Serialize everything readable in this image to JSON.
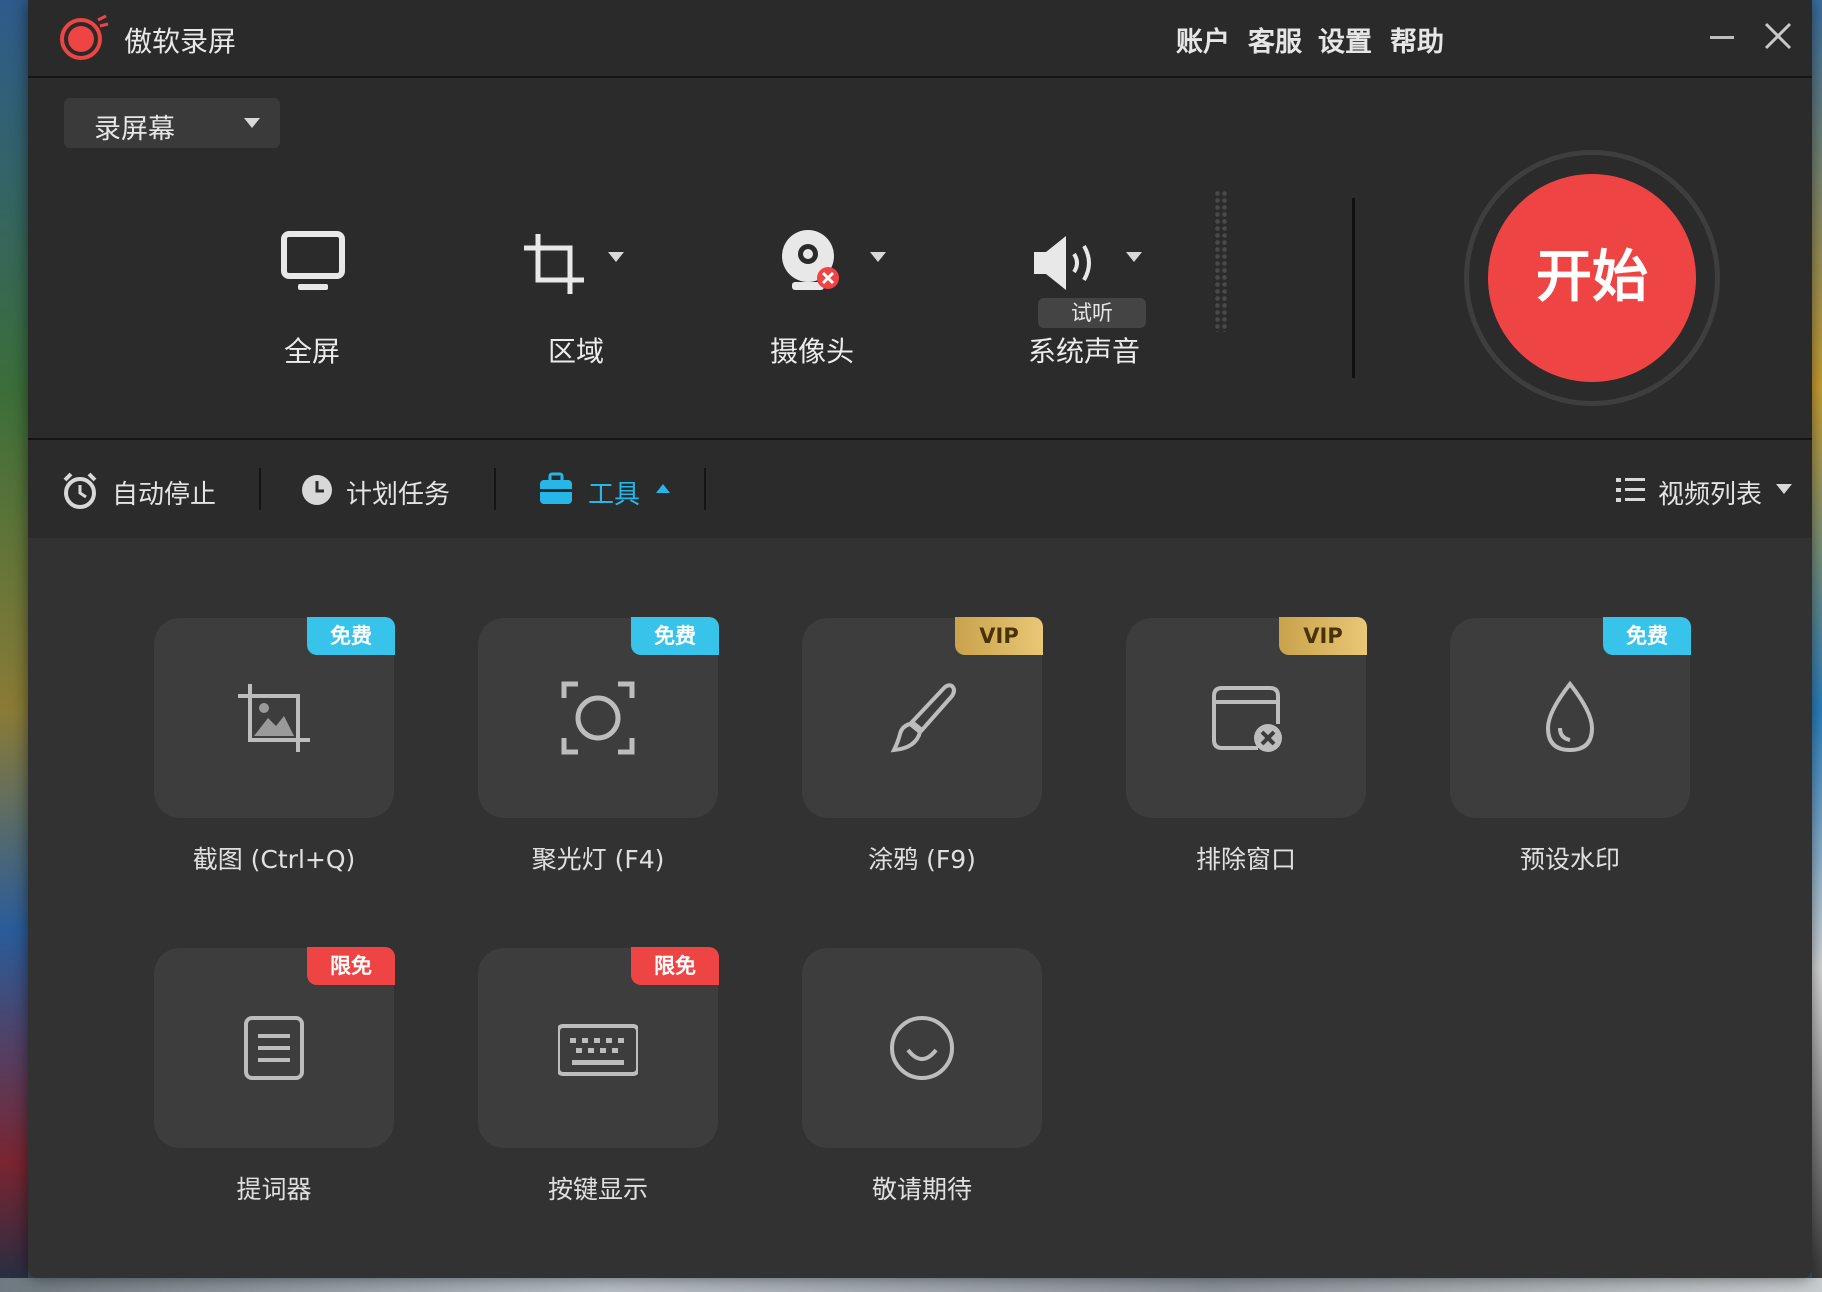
{
  "app": {
    "title": "傲软录屏",
    "menu": [
      "账户",
      "客服",
      "设置",
      "帮助"
    ]
  },
  "mode_dropdown": {
    "selected": "录屏幕"
  },
  "sources": [
    {
      "label": "全屏",
      "icon": "monitor-icon"
    },
    {
      "label": "区域",
      "icon": "crop-icon"
    },
    {
      "label": "摄像头",
      "icon": "webcam-icon"
    },
    {
      "label": "系统声音",
      "icon": "speaker-icon",
      "chip": "试听"
    }
  ],
  "start_button": {
    "label": "开始",
    "color": "#ef4444"
  },
  "toolbar": {
    "auto_stop": "自动停止",
    "schedule": "计划任务",
    "tools": "工具",
    "video_list": "视频列表"
  },
  "tools": [
    {
      "label": "截图 (Ctrl+Q)",
      "badge": "免费",
      "badge_type": "free",
      "icon": "screenshot-icon"
    },
    {
      "label": "聚光灯 (F4)",
      "badge": "免费",
      "badge_type": "free",
      "icon": "spotlight-icon"
    },
    {
      "label": "涂鸦 (F9)",
      "badge": "VIP",
      "badge_type": "vip",
      "icon": "brush-icon"
    },
    {
      "label": "排除窗口",
      "badge": "VIP",
      "badge_type": "vip",
      "icon": "exclude-window-icon"
    },
    {
      "label": "预设水印",
      "badge": "免费",
      "badge_type": "free",
      "icon": "watermark-drop-icon"
    },
    {
      "label": "提词器",
      "badge": "限免",
      "badge_type": "limited",
      "icon": "teleprompter-icon"
    },
    {
      "label": "按键显示",
      "badge": "限免",
      "badge_type": "limited",
      "icon": "keyboard-icon"
    },
    {
      "label": "敬请期待",
      "badge": "",
      "badge_type": "none",
      "icon": "smile-icon"
    }
  ],
  "colors": {
    "accent": "#27b6e8",
    "free_badge": "#38c3ea",
    "vip_badge": "#d4b05e",
    "limited_badge": "#ef4444",
    "background": "#2b2b2b"
  }
}
